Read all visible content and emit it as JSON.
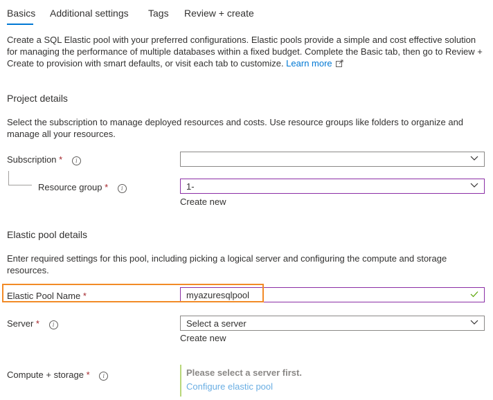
{
  "tabs": [
    {
      "label": "Basics",
      "active": true
    },
    {
      "label": "Additional settings",
      "active": false
    },
    {
      "label": "Tags",
      "active": false
    },
    {
      "label": "Review + create",
      "active": false
    }
  ],
  "intro": {
    "text": "Create a SQL Elastic pool with your preferred configurations. Elastic pools provide a simple and cost effective solution for managing the performance of multiple databases within a fixed budget. Complete the Basic tab, then go to Review + Create to provision with smart defaults, or visit each tab to customize. ",
    "learn_more": "Learn more",
    "learn_more_icon": "external-link-icon"
  },
  "project_details": {
    "title": "Project details",
    "description": "Select the subscription to manage deployed resources and costs. Use resource groups like folders to organize and manage all your resources.",
    "subscription": {
      "label": "Subscription",
      "required": "*",
      "value": ""
    },
    "resource_group": {
      "label": "Resource group",
      "required": "*",
      "value": "1-",
      "create_new": "Create new"
    }
  },
  "pool_details": {
    "title": "Elastic pool details",
    "description": "Enter required settings for this pool, including picking a logical server and configuring the compute and storage resources.",
    "pool_name": {
      "label": "Elastic Pool Name",
      "required": "*",
      "value": "myazuresqlpool",
      "valid": true
    },
    "server": {
      "label": "Server",
      "required": "*",
      "placeholder": "Select a server",
      "create_new": "Create new"
    },
    "compute": {
      "label": "Compute + storage",
      "required": "*",
      "message": "Please select a server first.",
      "configure_link": "Configure elastic pool"
    }
  },
  "colors": {
    "accent": "#0078d4",
    "required": "#a4262c",
    "focus_border": "#8a2da5",
    "highlight": "#f28a26",
    "valid_check": "#57a300",
    "compute_bar": "#b8d77a"
  }
}
